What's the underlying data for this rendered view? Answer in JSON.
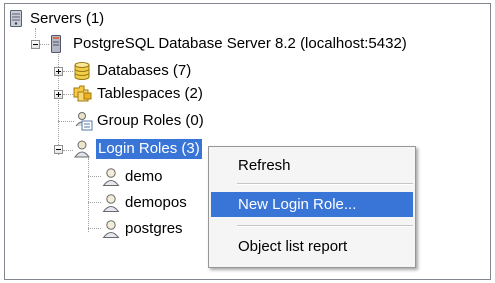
{
  "tree": {
    "servers": {
      "label": "Servers (1)",
      "icon": "servers-icon"
    },
    "server": {
      "label": "PostgreSQL Database Server 8.2 (localhost:5432)",
      "icon": "server-icon"
    },
    "databases": {
      "label": "Databases (7)",
      "icon": "database-icon"
    },
    "tablespaces": {
      "label": "Tablespaces (2)",
      "icon": "tablespace-icon"
    },
    "group_roles": {
      "label": "Group Roles (0)",
      "icon": "group-roles-icon"
    },
    "login_roles": {
      "label": "Login Roles (3)",
      "icon": "login-roles-icon"
    },
    "roles": [
      {
        "label": "demo",
        "icon": "user-icon"
      },
      {
        "label": "demopos",
        "icon": "user-icon"
      },
      {
        "label": "postgres",
        "icon": "user-icon"
      }
    ]
  },
  "context_menu": {
    "items": [
      {
        "label": "Refresh"
      },
      {
        "label": "New Login Role..."
      },
      {
        "label": "Object list report"
      }
    ],
    "highlighted_index": 1
  },
  "colors": {
    "selection": "#3875d7",
    "menu_background": "#f5f5f5"
  }
}
